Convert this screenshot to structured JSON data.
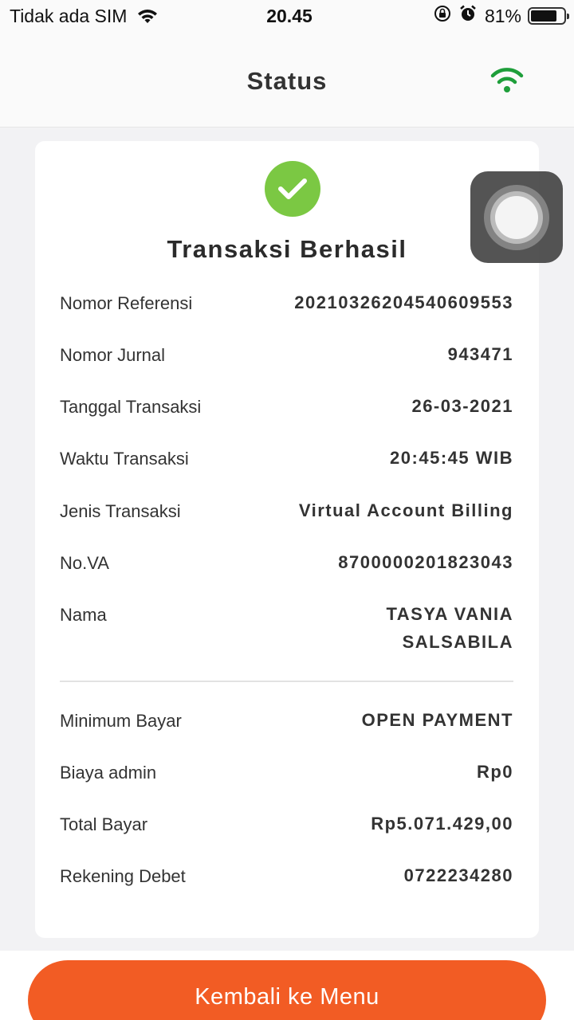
{
  "status_bar": {
    "carrier": "Tidak ada SIM",
    "time": "20.45",
    "battery": "81%",
    "battery_level": 0.81
  },
  "header": {
    "title": "Status",
    "connection_color": "#1e9e3a"
  },
  "card": {
    "heading": "Transaksi Berhasil",
    "success_color": "#7bc843",
    "details": [
      {
        "label": "Nomor Referensi",
        "value": "20210326204540609553"
      },
      {
        "label": "Nomor Jurnal",
        "value": "943471"
      },
      {
        "label": "Tanggal Transaksi",
        "value": "26-03-2021"
      },
      {
        "label": "Waktu Transaksi",
        "value": "20:45:45 WIB"
      },
      {
        "label": "Jenis Transaksi",
        "value": "Virtual Account Billing"
      },
      {
        "label": "No.VA",
        "value": "8700000201823043"
      },
      {
        "label": "Nama",
        "value_line1": "TASYA VANIA",
        "value_line2": "SALSABILA"
      }
    ],
    "payment": [
      {
        "label": "Minimum Bayar",
        "value": "OPEN PAYMENT"
      },
      {
        "label": "Biaya admin",
        "value": "Rp0"
      },
      {
        "label": "Total Bayar",
        "value": "Rp5.071.429,00"
      },
      {
        "label": "Rekening Debet",
        "value": "0722234280"
      }
    ]
  },
  "footer": {
    "button_label": "Kembali ke Menu",
    "button_color": "#f25c24"
  }
}
